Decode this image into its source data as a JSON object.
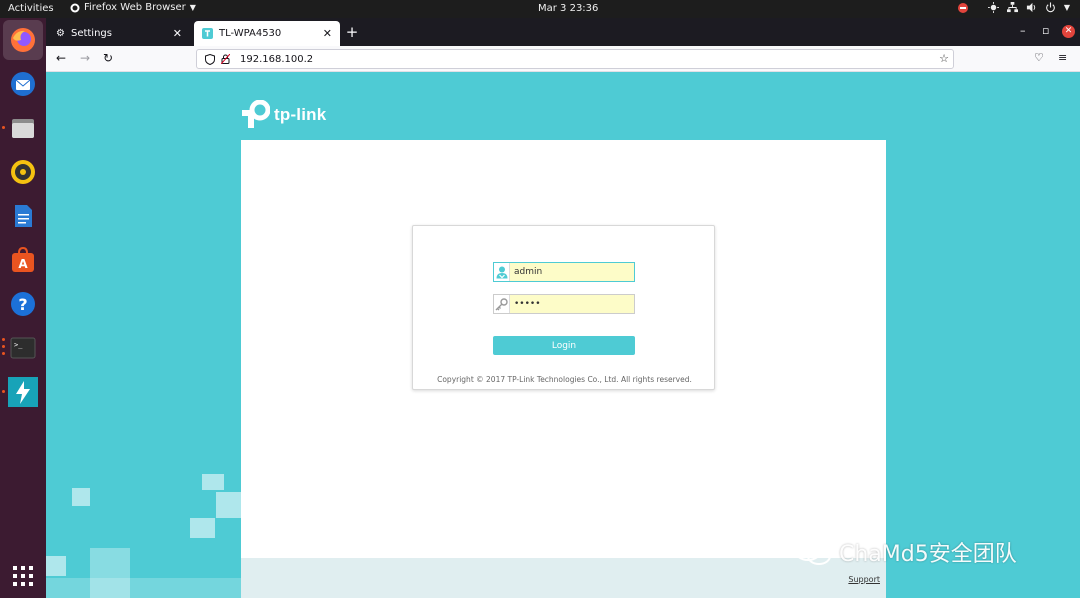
{
  "topbar": {
    "activities": "Activities",
    "app_name": "Firefox Web Browser",
    "clock": "Mar 3  23:36"
  },
  "dock": {
    "items": [
      "firefox-icon",
      "thunderbird-icon",
      "files-icon",
      "rhythmbox-icon",
      "writer-icon",
      "software-icon",
      "help-icon",
      "terminal-icon",
      "app-icon"
    ]
  },
  "browser": {
    "tabs": [
      {
        "label": "Settings"
      },
      {
        "label": "TL-WPA4530"
      }
    ],
    "url": "192.168.100.2"
  },
  "page": {
    "brand": "tp-link",
    "login": {
      "username_value": "admin",
      "password_value": "•••••",
      "login_label": "Login",
      "copyright": "Copyright © 2017 TP-Link Technologies Co., Ltd. All rights reserved."
    },
    "support_link": "Support"
  },
  "watermark": "ChaMd5安全团队",
  "colors": {
    "tplink_teal": "#4ecbd4",
    "dock_bg": "#3c1b31",
    "topbar_bg": "#1d1d1d",
    "input_autofill": "#fdfcc8"
  }
}
